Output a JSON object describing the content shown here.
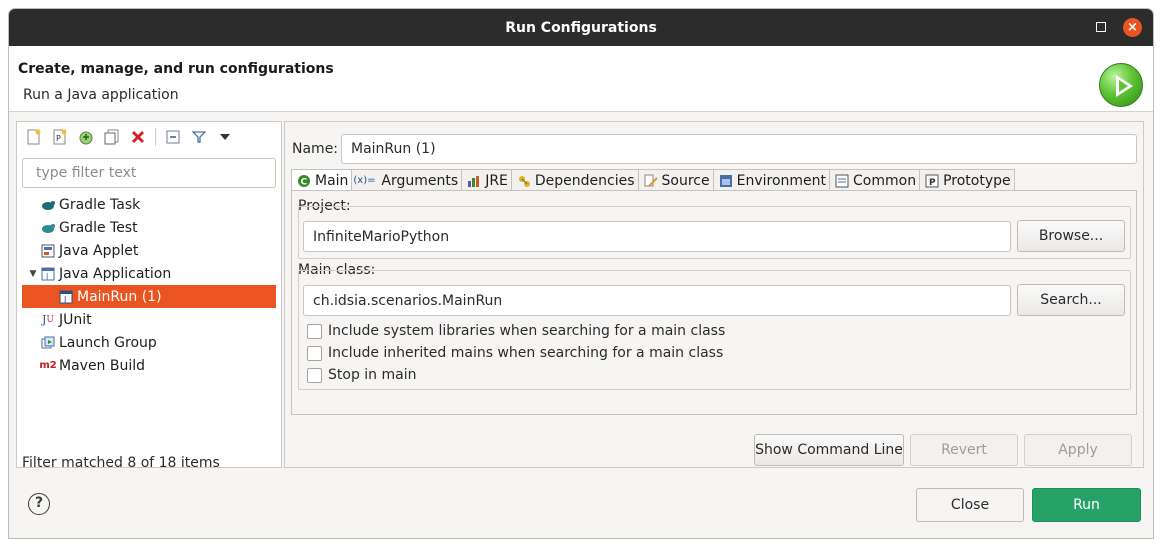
{
  "window": {
    "title": "Run Configurations"
  },
  "header": {
    "title": "Create, manage, and run configurations",
    "subtitle": "Run a Java application"
  },
  "left": {
    "toolbar": [
      {
        "name": "new-configuration-icon"
      },
      {
        "name": "new-prototype-icon"
      },
      {
        "name": "export-icon"
      },
      {
        "name": "duplicate-icon"
      },
      {
        "name": "delete-icon"
      },
      {
        "name": "collapse-all-icon"
      },
      {
        "name": "filter-icon"
      },
      {
        "name": "view-menu-icon"
      }
    ],
    "filter_placeholder": "type filter text",
    "tree": [
      {
        "label": "Gradle Task",
        "icon": "gradle-icon",
        "level": 1
      },
      {
        "label": "Gradle Test",
        "icon": "gradle-icon",
        "level": 1
      },
      {
        "label": "Java Applet",
        "icon": "applet-icon",
        "level": 1
      },
      {
        "label": "Java Application",
        "icon": "java-app-icon",
        "level": 1,
        "expanded": true
      },
      {
        "label": "MainRun (1)",
        "icon": "java-app-icon",
        "level": 2,
        "selected": true
      },
      {
        "label": "JUnit",
        "icon": "junit-icon",
        "level": 1
      },
      {
        "label": "Launch Group",
        "icon": "launch-group-icon",
        "level": 1
      },
      {
        "label": "Maven Build",
        "icon": "maven-icon",
        "level": 1
      }
    ],
    "status": "Filter matched 8 of 18 items"
  },
  "right": {
    "name_label": "Name:",
    "name_value": "MainRun (1)",
    "tabs": [
      {
        "label": "Main",
        "icon": "main-tab-icon",
        "active": true
      },
      {
        "label": "Arguments",
        "icon": "arguments-icon"
      },
      {
        "label": "JRE",
        "icon": "jre-icon"
      },
      {
        "label": "Dependencies",
        "icon": "dependencies-icon"
      },
      {
        "label": "Source",
        "icon": "source-icon"
      },
      {
        "label": "Environment",
        "icon": "environment-icon"
      },
      {
        "label": "Common",
        "icon": "common-icon"
      },
      {
        "label": "Prototype",
        "icon": "prototype-icon"
      }
    ],
    "project_label": "Project:",
    "project_value": "InfiniteMarioPython",
    "browse_label": "Browse...",
    "main_class_label": "Main class:",
    "main_class_value": "ch.idsia.scenarios.MainRun",
    "search_label": "Search...",
    "checkboxes": [
      {
        "label": "Include system libraries when searching for a main class",
        "checked": false
      },
      {
        "label": "Include inherited mains when searching for a main class",
        "checked": false
      },
      {
        "label": "Stop in main",
        "checked": false
      }
    ],
    "show_cmd_label": "Show Command Line",
    "revert_label": "Revert",
    "apply_label": "Apply"
  },
  "footer": {
    "help": "?",
    "close_label": "Close",
    "run_label": "Run"
  },
  "colors": {
    "selection": "#e95420",
    "run_button": "#26a269",
    "titlebar": "#2c2c2c"
  }
}
